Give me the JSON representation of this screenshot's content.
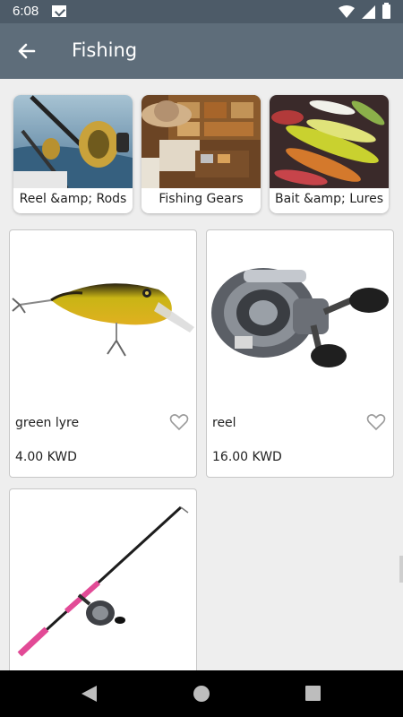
{
  "status_bar": {
    "time": "6:08"
  },
  "app_bar": {
    "title": "Fishing",
    "color": "#5e6d7a"
  },
  "categories": [
    {
      "label": "Reel &amp; Rods"
    },
    {
      "label": "Fishing Gears"
    },
    {
      "label": "Bait &amp; Lures"
    }
  ],
  "products": [
    {
      "name": "green lyre",
      "price": "4.00 KWD"
    },
    {
      "name": "reel",
      "price": "16.00 KWD"
    },
    {
      "name": "",
      "price": ""
    }
  ]
}
